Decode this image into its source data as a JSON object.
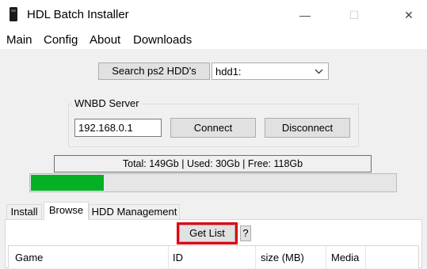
{
  "window": {
    "title": "HDL Batch Installer",
    "icon": "ps2-hdd-icon",
    "controls": {
      "minimize": "—",
      "maximize": "☐",
      "close": "✕"
    }
  },
  "menu": [
    "Main",
    "Config",
    "About",
    "Downloads"
  ],
  "search": {
    "button_label": "Search ps2 HDD's",
    "drive_selected": "hdd1:"
  },
  "wnbd": {
    "group_label": "WNBD Server",
    "ip_value": "192.168.0.1",
    "connect_label": "Connect",
    "disconnect_label": "Disconnect"
  },
  "disk": {
    "status_text": "Total: 149Gb | Used: 30Gb | Free: 118Gb",
    "used_fraction": 0.2,
    "bar_color": "#06b025"
  },
  "tabs": [
    {
      "label": "Install",
      "active": false
    },
    {
      "label": "Browse",
      "active": true
    },
    {
      "label": "HDD Management",
      "active": false
    }
  ],
  "browse": {
    "get_list_label": "Get List",
    "help_label": "?",
    "highlight_color": "#e0000f",
    "columns": [
      "Game",
      "ID",
      "size (MB)",
      "Media"
    ]
  }
}
